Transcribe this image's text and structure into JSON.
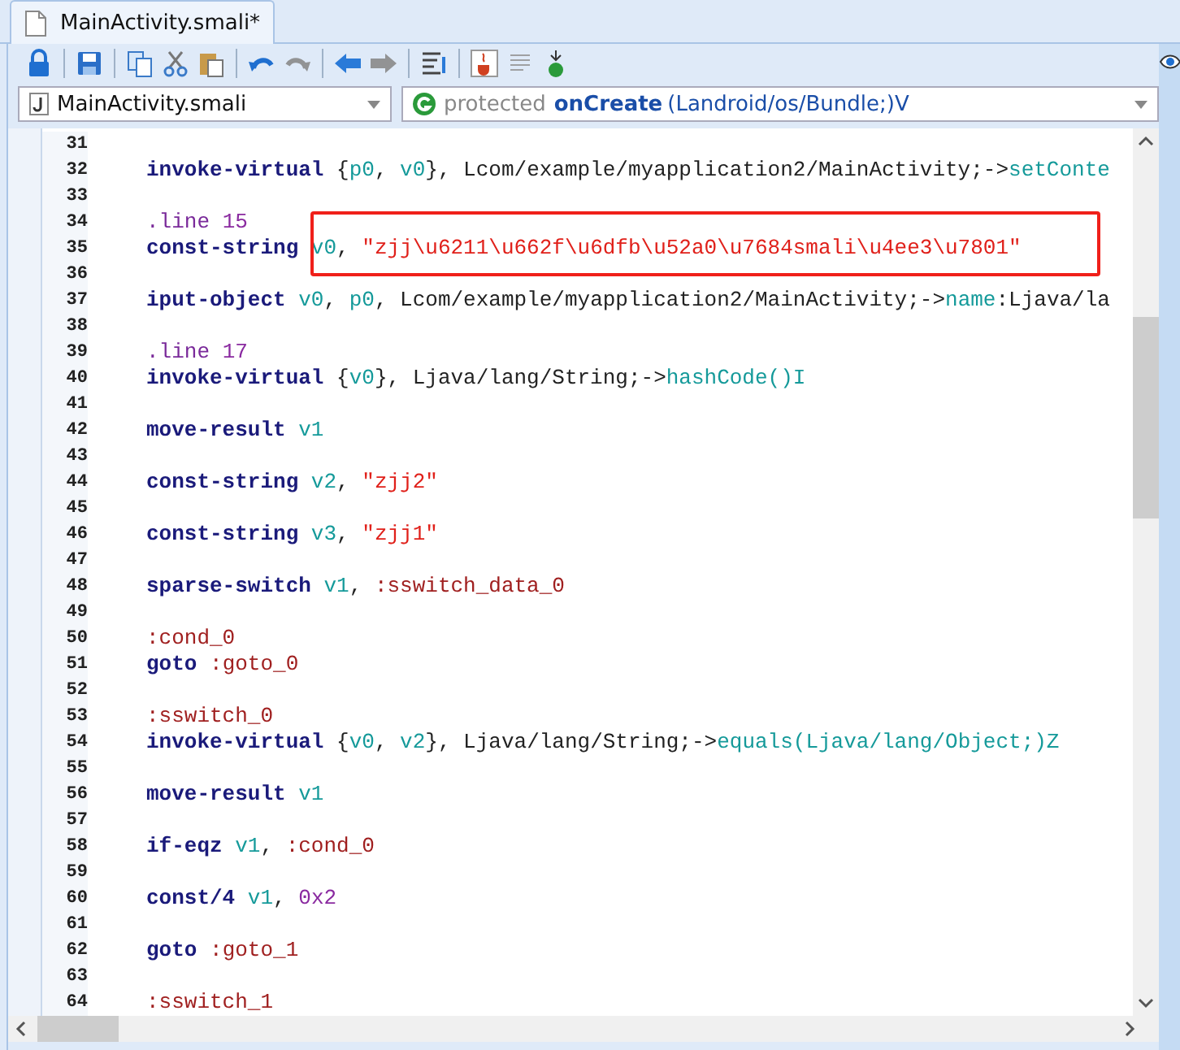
{
  "tab": {
    "title": "MainActivity.smali*",
    "selected": true
  },
  "toolbar": [
    {
      "kind": "lock",
      "disabled": false
    },
    {
      "kind": "sep"
    },
    {
      "kind": "save",
      "disabled": false
    },
    {
      "kind": "sep"
    },
    {
      "kind": "copy",
      "disabled": false
    },
    {
      "kind": "cut",
      "disabled": false
    },
    {
      "kind": "paste",
      "disabled": false
    },
    {
      "kind": "sep"
    },
    {
      "kind": "undo",
      "disabled": false
    },
    {
      "kind": "redo",
      "disabled": true
    },
    {
      "kind": "sep"
    },
    {
      "kind": "back",
      "disabled": false
    },
    {
      "kind": "forward",
      "disabled": true
    },
    {
      "kind": "sep"
    },
    {
      "kind": "format",
      "disabled": false
    },
    {
      "kind": "sep"
    },
    {
      "kind": "java",
      "disabled": false
    },
    {
      "kind": "lines",
      "disabled": true
    },
    {
      "kind": "gdown",
      "disabled": false
    }
  ],
  "file_select": {
    "value": "MainActivity.smali"
  },
  "method_select": {
    "modifier": "protected",
    "name": "onCreate",
    "signature": "(Landroid/os/Bundle;)V"
  },
  "lines": [
    {
      "number": "31",
      "boxed": false
    },
    {
      "number": "32",
      "boxed": false,
      "tokens": [
        {
          "text": "invoke-virtual",
          "kind": "kw"
        },
        {
          "text": " {",
          "kind": "plain"
        },
        {
          "text": "p0",
          "kind": "reg"
        },
        {
          "text": ", ",
          "kind": "plain"
        },
        {
          "text": "v0",
          "kind": "reg"
        },
        {
          "text": "}, Lcom/example/myapplication2/MainActivity;->",
          "kind": "plain"
        },
        {
          "text": "setConte",
          "kind": "member"
        }
      ]
    },
    {
      "number": "33",
      "boxed": false
    },
    {
      "number": "34",
      "boxed": false,
      "tokens": [
        {
          "text": ".line ",
          "kind": "dir"
        },
        {
          "text": "15",
          "kind": "num"
        }
      ]
    },
    {
      "number": "35",
      "boxed": true,
      "tokens": [
        {
          "text": "const-string ",
          "kind": "kw"
        },
        {
          "text": "v0",
          "kind": "reg"
        },
        {
          "text": ", ",
          "kind": "plain"
        },
        {
          "text": "\"zjj\\u6211\\u662f\\u6dfb\\u52a0\\u7684smali\\u4ee3\\u7801\"",
          "kind": "str"
        }
      ]
    },
    {
      "number": "36",
      "boxed": false
    },
    {
      "number": "37",
      "boxed": false,
      "tokens": [
        {
          "text": "iput-object ",
          "kind": "kw"
        },
        {
          "text": "v0",
          "kind": "reg"
        },
        {
          "text": ", ",
          "kind": "plain"
        },
        {
          "text": "p0",
          "kind": "reg"
        },
        {
          "text": ", Lcom/example/myapplication2/MainActivity;->",
          "kind": "plain"
        },
        {
          "text": "name",
          "kind": "member"
        },
        {
          "text": ":Ljava/la",
          "kind": "plain"
        }
      ]
    },
    {
      "number": "38",
      "boxed": false
    },
    {
      "number": "39",
      "boxed": false,
      "tokens": [
        {
          "text": ".line ",
          "kind": "dir"
        },
        {
          "text": "17",
          "kind": "num"
        }
      ]
    },
    {
      "number": "40",
      "boxed": false,
      "tokens": [
        {
          "text": "invoke-virtual",
          "kind": "kw"
        },
        {
          "text": " {",
          "kind": "plain"
        },
        {
          "text": "v0",
          "kind": "reg"
        },
        {
          "text": "}, Ljava/lang/String;->",
          "kind": "plain"
        },
        {
          "text": "hashCode()I",
          "kind": "member"
        }
      ]
    },
    {
      "number": "41",
      "boxed": false
    },
    {
      "number": "42",
      "boxed": false,
      "tokens": [
        {
          "text": "move-result ",
          "kind": "kw"
        },
        {
          "text": "v1",
          "kind": "reg"
        }
      ]
    },
    {
      "number": "43",
      "boxed": false
    },
    {
      "number": "44",
      "boxed": false,
      "tokens": [
        {
          "text": "const-string ",
          "kind": "kw"
        },
        {
          "text": "v2",
          "kind": "reg"
        },
        {
          "text": ", ",
          "kind": "plain"
        },
        {
          "text": "\"zjj2\"",
          "kind": "str"
        }
      ]
    },
    {
      "number": "45",
      "boxed": false
    },
    {
      "number": "46",
      "boxed": false,
      "tokens": [
        {
          "text": "const-string ",
          "kind": "kw"
        },
        {
          "text": "v3",
          "kind": "reg"
        },
        {
          "text": ", ",
          "kind": "plain"
        },
        {
          "text": "\"zjj1\"",
          "kind": "str"
        }
      ]
    },
    {
      "number": "47",
      "boxed": false
    },
    {
      "number": "48",
      "boxed": false,
      "tokens": [
        {
          "text": "sparse-switch ",
          "kind": "kw"
        },
        {
          "text": "v1",
          "kind": "reg"
        },
        {
          "text": ", ",
          "kind": "plain"
        },
        {
          "text": ":sswitch_data_0",
          "kind": "label"
        }
      ]
    },
    {
      "number": "49",
      "boxed": false
    },
    {
      "number": "50",
      "boxed": false,
      "tokens": [
        {
          "text": ":cond_0",
          "kind": "label"
        }
      ]
    },
    {
      "number": "51",
      "boxed": false,
      "tokens": [
        {
          "text": "goto ",
          "kind": "kw"
        },
        {
          "text": ":goto_0",
          "kind": "label"
        }
      ]
    },
    {
      "number": "52",
      "boxed": false
    },
    {
      "number": "53",
      "boxed": false,
      "tokens": [
        {
          "text": ":sswitch_0",
          "kind": "label"
        }
      ]
    },
    {
      "number": "54",
      "boxed": false,
      "tokens": [
        {
          "text": "invoke-virtual",
          "kind": "kw"
        },
        {
          "text": " {",
          "kind": "plain"
        },
        {
          "text": "v0",
          "kind": "reg"
        },
        {
          "text": ", ",
          "kind": "plain"
        },
        {
          "text": "v2",
          "kind": "reg"
        },
        {
          "text": "}, Ljava/lang/String;->",
          "kind": "plain"
        },
        {
          "text": "equals(Ljava/lang/Object;)Z",
          "kind": "member"
        }
      ]
    },
    {
      "number": "55",
      "boxed": false
    },
    {
      "number": "56",
      "boxed": false,
      "tokens": [
        {
          "text": "move-result ",
          "kind": "kw"
        },
        {
          "text": "v1",
          "kind": "reg"
        }
      ]
    },
    {
      "number": "57",
      "boxed": false
    },
    {
      "number": "58",
      "boxed": false,
      "tokens": [
        {
          "text": "if-eqz ",
          "kind": "kw"
        },
        {
          "text": "v1",
          "kind": "reg"
        },
        {
          "text": ", ",
          "kind": "plain"
        },
        {
          "text": ":cond_0",
          "kind": "label"
        }
      ]
    },
    {
      "number": "59",
      "boxed": false
    },
    {
      "number": "60",
      "boxed": false,
      "tokens": [
        {
          "text": "const/4 ",
          "kind": "kw"
        },
        {
          "text": "v1",
          "kind": "reg"
        },
        {
          "text": ", ",
          "kind": "plain"
        },
        {
          "text": "0x2",
          "kind": "num"
        }
      ]
    },
    {
      "number": "61",
      "boxed": false
    },
    {
      "number": "62",
      "boxed": false,
      "tokens": [
        {
          "text": "goto ",
          "kind": "kw"
        },
        {
          "text": ":goto_1",
          "kind": "label"
        }
      ]
    },
    {
      "number": "63",
      "boxed": false
    },
    {
      "number": "64",
      "boxed": false,
      "tokens": [
        {
          "text": ":sswitch_1",
          "kind": "label"
        }
      ]
    }
  ]
}
